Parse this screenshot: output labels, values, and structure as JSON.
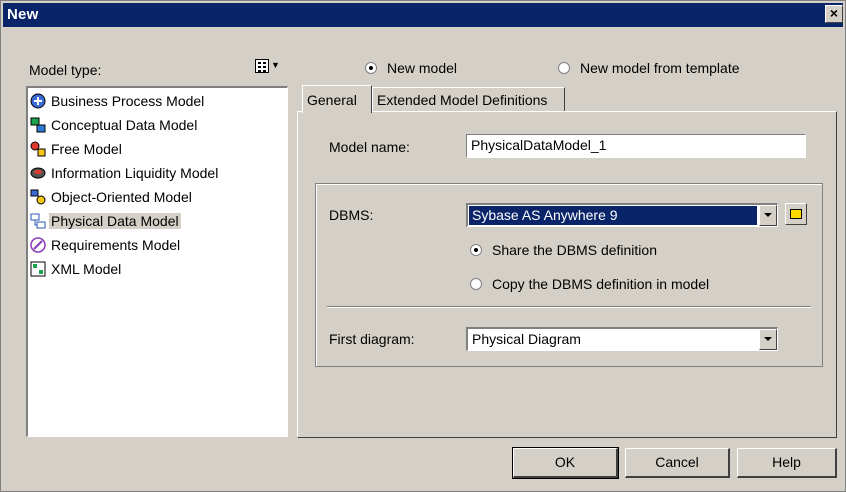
{
  "window": {
    "title": "New",
    "close_glyph": "×"
  },
  "model_type": {
    "label": "Model type:",
    "items": [
      {
        "label": "Business Process Model",
        "icon": "business-process-icon",
        "selected": false
      },
      {
        "label": "Conceptual Data Model",
        "icon": "conceptual-data-icon",
        "selected": false
      },
      {
        "label": "Free Model",
        "icon": "free-model-icon",
        "selected": false
      },
      {
        "label": "Information Liquidity Model",
        "icon": "information-liquidity-icon",
        "selected": false
      },
      {
        "label": "Object-Oriented Model",
        "icon": "object-oriented-icon",
        "selected": false
      },
      {
        "label": "Physical Data Model",
        "icon": "physical-data-icon",
        "selected": true
      },
      {
        "label": "Requirements Model",
        "icon": "requirements-icon",
        "selected": false
      },
      {
        "label": "XML Model",
        "icon": "xml-model-icon",
        "selected": false
      }
    ]
  },
  "creation": {
    "new_model_label": "New model",
    "from_template_label": "New model from template",
    "selected": "new_model"
  },
  "tabs": [
    {
      "label": "General",
      "active": true
    },
    {
      "label": "Extended Model Definitions",
      "active": false
    }
  ],
  "general": {
    "model_name_label": "Model name:",
    "model_name_value": "PhysicalDataModel_1",
    "dbms_label": "DBMS:",
    "dbms_value": "Sybase AS Anywhere 9",
    "share_label": "Share the DBMS definition",
    "copy_label": "Copy the DBMS definition in model",
    "dbms_option": "share",
    "first_diagram_label": "First diagram:",
    "first_diagram_value": "Physical Diagram"
  },
  "buttons": {
    "ok": "OK",
    "cancel": "Cancel",
    "help": "Help"
  },
  "colors": {
    "face": "#d4d0c8",
    "title_bar": "#0a246a",
    "highlight": "#0a246a"
  }
}
